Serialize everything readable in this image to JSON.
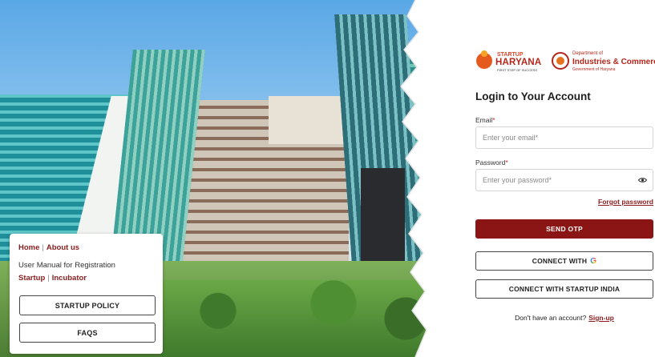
{
  "info_card": {
    "home": "Home",
    "about": "About us",
    "manual": "User Manual for Registration",
    "startup": "Startup",
    "incubator": "Incubator",
    "startup_policy": "STARTUP POLICY",
    "faqs": "FAQS"
  },
  "logos": {
    "startup_top": "STARTUP",
    "startup_main": "HARYANA",
    "startup_tag": "FIRST STEP OF SUCCESS",
    "dept_top": "Department of",
    "dept_main": "Industries & Commerce",
    "dept_sub": "Government of Haryana"
  },
  "login": {
    "title": "Login to Your Account",
    "email_label": "Email",
    "email_placeholder": "Enter your email*",
    "password_label": "Password",
    "password_placeholder": "Enter your password*",
    "required_mark": "*",
    "forgot": "Forgot password",
    "send_otp": "SEND OTP",
    "connect_with": "CONNECT WITH",
    "google_glyph": "G",
    "connect_startup_india": "CONNECT WITH STARTUP INDIA",
    "no_account": "Don't have an account?",
    "signup": "Sign-up"
  },
  "colors": {
    "brand_maroon": "#8b1414",
    "link_maroon": "#8b1d1d",
    "required_red": "#c62828"
  },
  "icons": {
    "password_toggle": "eye-icon",
    "google": "google-icon"
  }
}
